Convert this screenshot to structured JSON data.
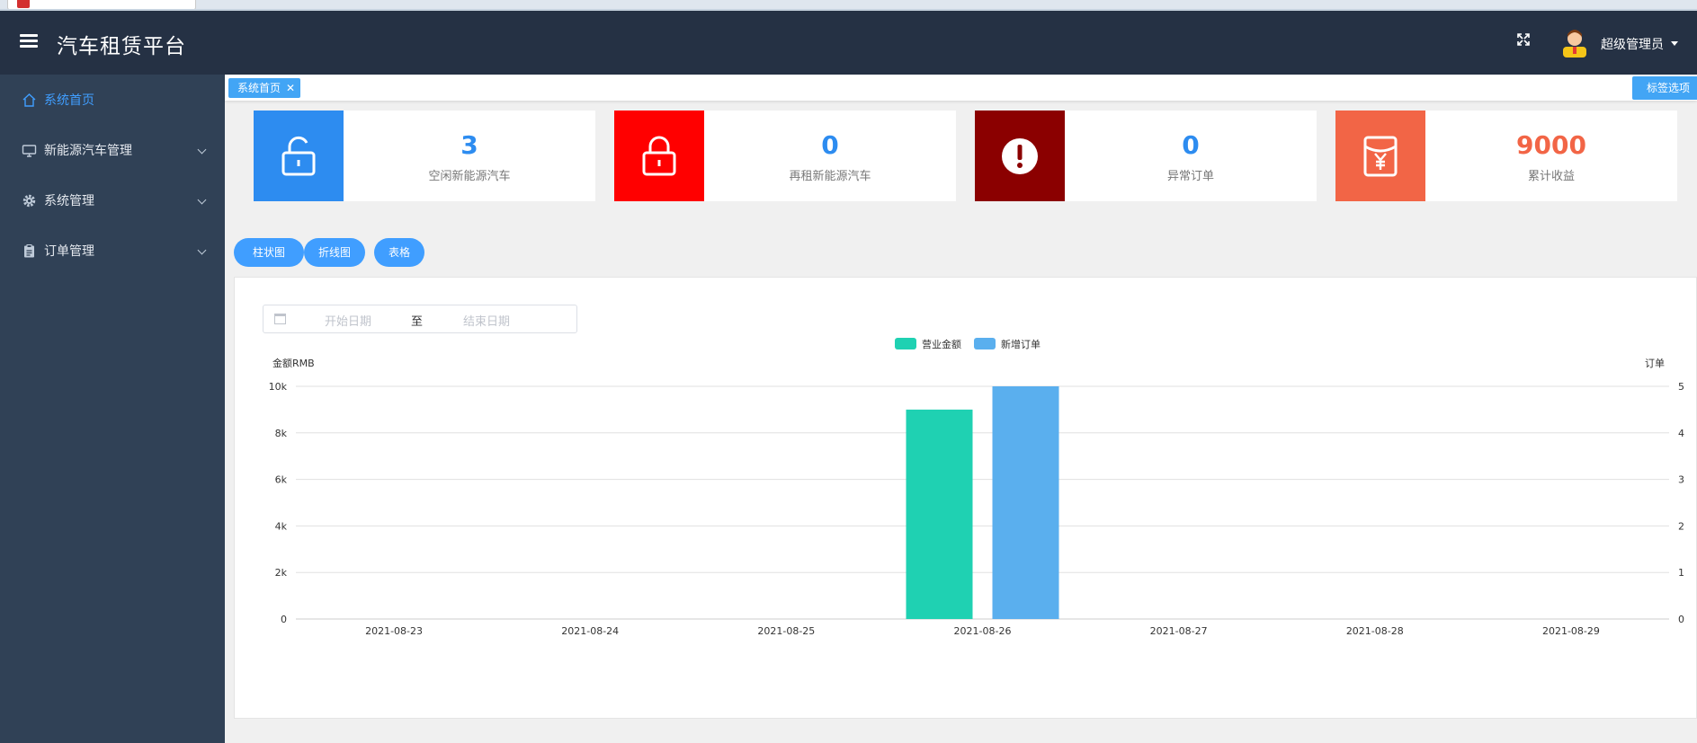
{
  "app": {
    "title": "汽车租赁平台"
  },
  "header": {
    "username": "超级管理员"
  },
  "sidebar": {
    "items": [
      {
        "label": "系统首页",
        "icon": "home-icon",
        "active": true
      },
      {
        "label": "新能源汽车管理",
        "icon": "monitor-icon"
      },
      {
        "label": "系统管理",
        "icon": "gear-icon"
      },
      {
        "label": "订单管理",
        "icon": "clipboard-icon"
      }
    ]
  },
  "tags": {
    "active_label": "系统首页",
    "close": "✕",
    "options_label": "标签选项"
  },
  "cards": [
    {
      "value": "3",
      "label": "空闲新能源汽车",
      "icon": "unlock-icon",
      "color": "#2d8cf0",
      "value_color": "#2d8cf0"
    },
    {
      "value": "0",
      "label": "再租新能源汽车",
      "icon": "lock-icon",
      "color": "#ff0000",
      "value_color": "#2d8cf0"
    },
    {
      "value": "0",
      "label": "异常订单",
      "icon": "alert-icon",
      "color": "#8b0000",
      "value_color": "#2d8cf0"
    },
    {
      "value": "9000",
      "label": "累计收益",
      "icon": "money-bag-icon",
      "color": "#f26546",
      "value_color": "#f26546"
    }
  ],
  "view_buttons": [
    "柱状图",
    "折线图",
    "表格"
  ],
  "date_filter": {
    "start_placeholder": "开始日期",
    "separator": "至",
    "end_placeholder": "结束日期"
  },
  "chart_data": {
    "type": "bar",
    "categories": [
      "2021-08-23",
      "2021-08-24",
      "2021-08-25",
      "2021-08-26",
      "2021-08-27",
      "2021-08-28",
      "2021-08-29"
    ],
    "series": [
      {
        "name": "营业金额",
        "axis": "left",
        "color": "#1fd1b2",
        "values": [
          0,
          0,
          0,
          9000,
          0,
          0,
          0
        ]
      },
      {
        "name": "新增订单",
        "axis": "right",
        "color": "#5aafee",
        "values": [
          0,
          0,
          0,
          5,
          0,
          0,
          0
        ]
      }
    ],
    "ylabel": "金额RMB",
    "ylabel_right": "订单",
    "ylim": [
      0,
      10000
    ],
    "ylim_right": [
      0,
      5
    ],
    "yticks": [
      "0",
      "2k",
      "4k",
      "6k",
      "8k",
      "10k"
    ],
    "yticks_right": [
      "0",
      "1",
      "2",
      "3",
      "4",
      "5"
    ],
    "grid": true,
    "legend": "top-center"
  }
}
